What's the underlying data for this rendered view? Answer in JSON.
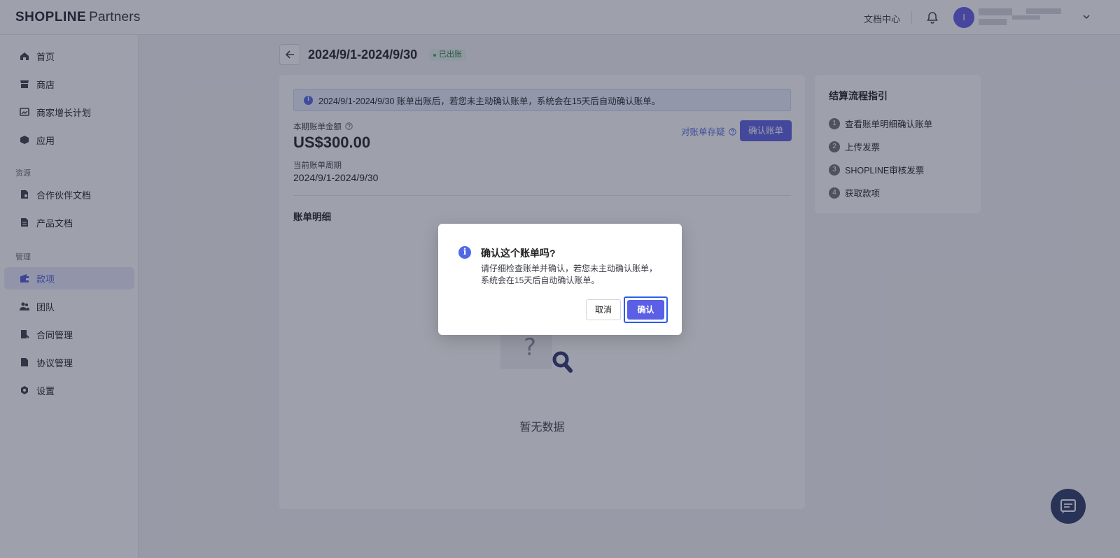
{
  "header": {
    "logo": {
      "brand_bold": "SHOPLINE",
      "brand_light": "Partners"
    },
    "doc_center": "文档中心",
    "avatar_initial": "I"
  },
  "sidebar": {
    "items_top": [
      {
        "label": "首页",
        "icon": "home-icon"
      },
      {
        "label": "商店",
        "icon": "store-icon"
      },
      {
        "label": "商家增长计划",
        "icon": "growth-chart-icon"
      },
      {
        "label": "应用",
        "icon": "app-cube-icon"
      }
    ],
    "section_resources": "资源",
    "items_resources": [
      {
        "label": "合作伙伴文档",
        "icon": "partner-doc-icon"
      },
      {
        "label": "产品文档",
        "icon": "product-doc-icon"
      }
    ],
    "section_manage": "管理",
    "items_manage": [
      {
        "label": "款项",
        "icon": "wallet-icon",
        "active": true
      },
      {
        "label": "团队",
        "icon": "team-icon"
      },
      {
        "label": "合同管理",
        "icon": "contract-icon"
      },
      {
        "label": "协议管理",
        "icon": "agreement-icon"
      },
      {
        "label": "设置",
        "icon": "settings-icon"
      }
    ]
  },
  "page": {
    "title": "2024/9/1-2024/9/30",
    "status_badge": "已出账"
  },
  "bill_card": {
    "banner_text": "2024/9/1-2024/9/30 账单出账后，若您未主动确认账单，系统会在15天后自动确认账单。",
    "amount_label": "本期账单金额",
    "amount_value": "US$300.00",
    "period_label": "当前账单周期",
    "period_value": "2024/9/1-2024/9/30",
    "dispute_link": "对账单存疑",
    "confirm_button": "确认账单",
    "detail_title": "账单明细",
    "empty_text": "暂无数据"
  },
  "guide": {
    "title": "结算流程指引",
    "steps": [
      {
        "num": "1",
        "label": "查看账单明细确认账单"
      },
      {
        "num": "2",
        "label": "上传发票"
      },
      {
        "num": "3",
        "label": "SHOPLINE审核发票"
      },
      {
        "num": "4",
        "label": "获取款项"
      }
    ]
  },
  "modal": {
    "title": "确认这个账单吗?",
    "body": "请仔细检查账单并确认，若您未主动确认账单，系统会在15天后自动确认账单。",
    "cancel_label": "取消",
    "ok_label": "确认"
  },
  "colors": {
    "accent": "#5b5fe6",
    "link": "#5068e6",
    "overlay": "rgba(40,45,68,0.45)"
  }
}
